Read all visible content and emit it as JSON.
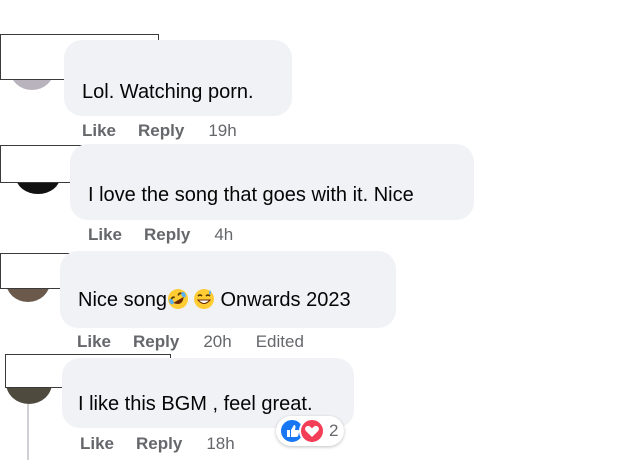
{
  "comments": [
    {
      "text": "Lol. Watching porn.",
      "like": "Like",
      "reply": "Reply",
      "time": "19h"
    },
    {
      "text": "I love the song that goes with it. Nice",
      "like": "Like",
      "reply": "Reply",
      "time": "4h"
    },
    {
      "text_before": "Nice song",
      "text_after": " Onwards 2023",
      "emojis": [
        "rolling-on-floor-laughing",
        "grinning-sweat"
      ],
      "like": "Like",
      "reply": "Reply",
      "time": "20h",
      "edited": "Edited"
    },
    {
      "text": "I like this BGM , feel great.",
      "like": "Like",
      "reply": "Reply",
      "time": "18h",
      "reactions": {
        "icons": [
          "like-icon",
          "love-icon"
        ],
        "count": "2",
        "like_color": "#1877f2",
        "love_color": "#f33e58"
      }
    }
  ],
  "colors": {
    "bubble": "#f0f2f5",
    "meta_text": "#65676b",
    "body_text": "#050505"
  }
}
